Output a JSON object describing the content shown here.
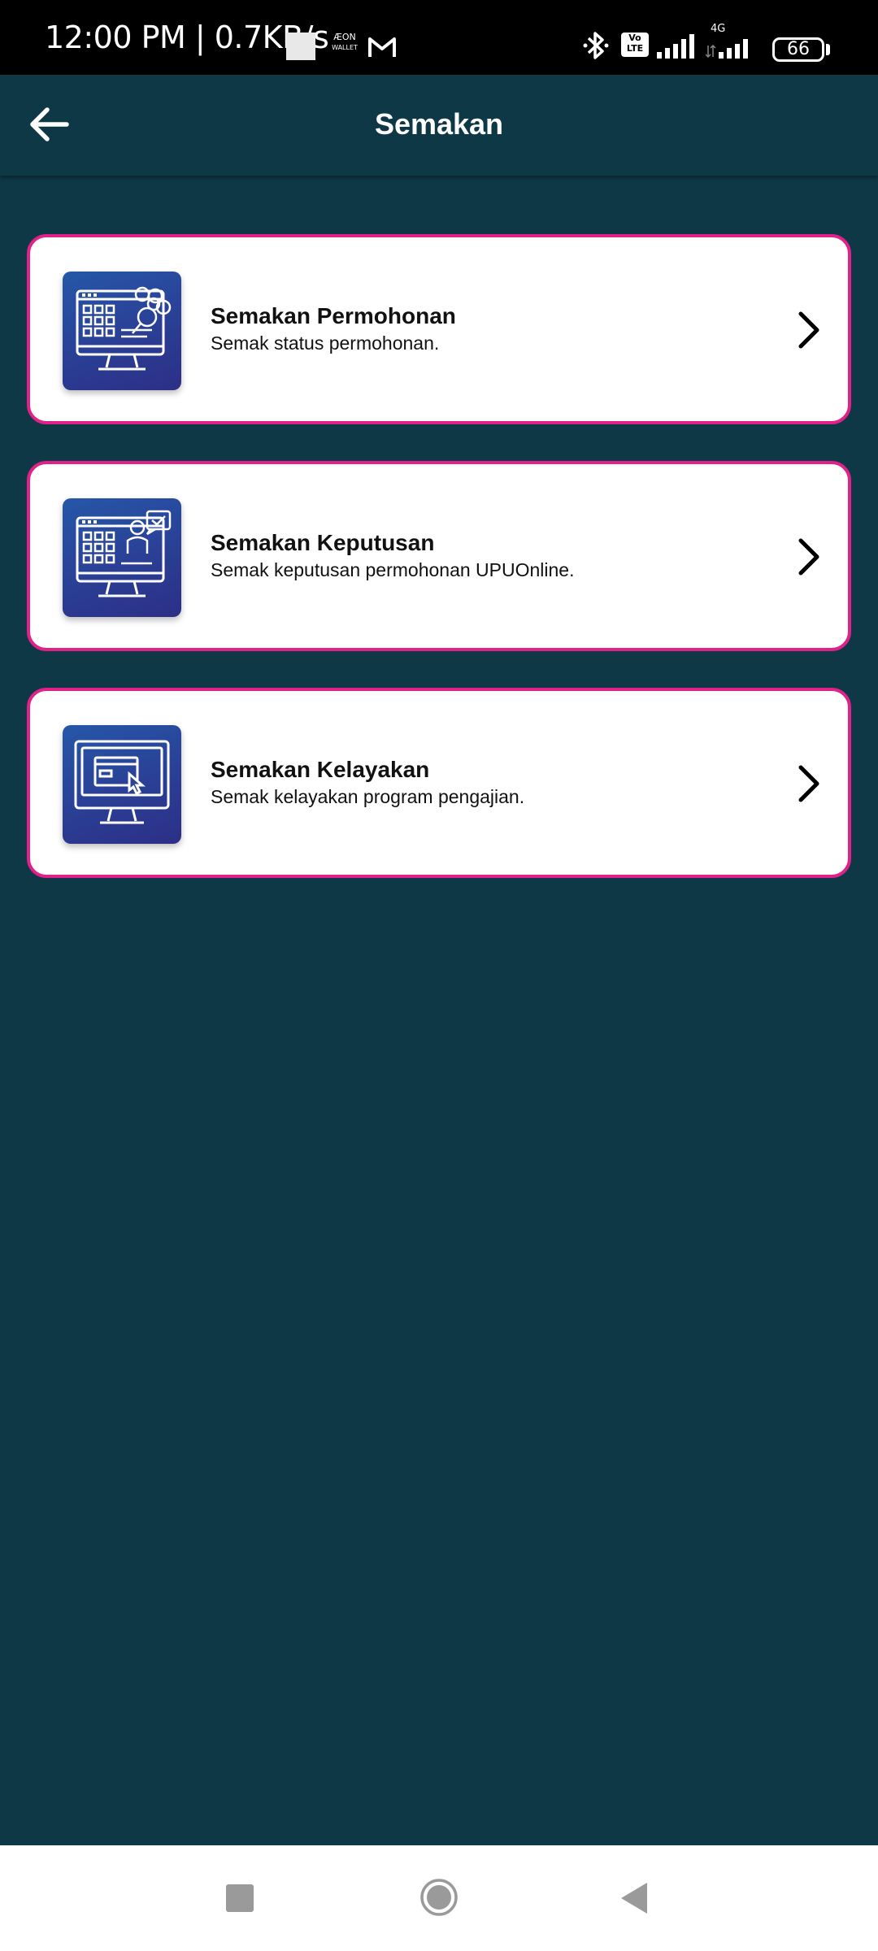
{
  "status_bar": {
    "time_speed": "12:00 PM | 0.7KB/s",
    "aeon_icon_text": "ÆON WALLET",
    "volte_label": "Vo LTE",
    "network_label": "4G",
    "battery_level": "66"
  },
  "app_bar": {
    "title": "Semakan"
  },
  "cards": [
    {
      "title": "Semakan Permohonan",
      "subtitle": "Semak status permohonan."
    },
    {
      "title": "Semakan Keputusan",
      "subtitle": "Semak keputusan permohonan UPUOnline."
    },
    {
      "title": "Semakan Kelayakan",
      "subtitle": "Semak kelayakan program pengajian."
    }
  ],
  "colors": {
    "background": "#0e3846",
    "card_border": "#e0218a",
    "icon_gradient_start": "#2657a8",
    "icon_gradient_end": "#2c2f86"
  }
}
